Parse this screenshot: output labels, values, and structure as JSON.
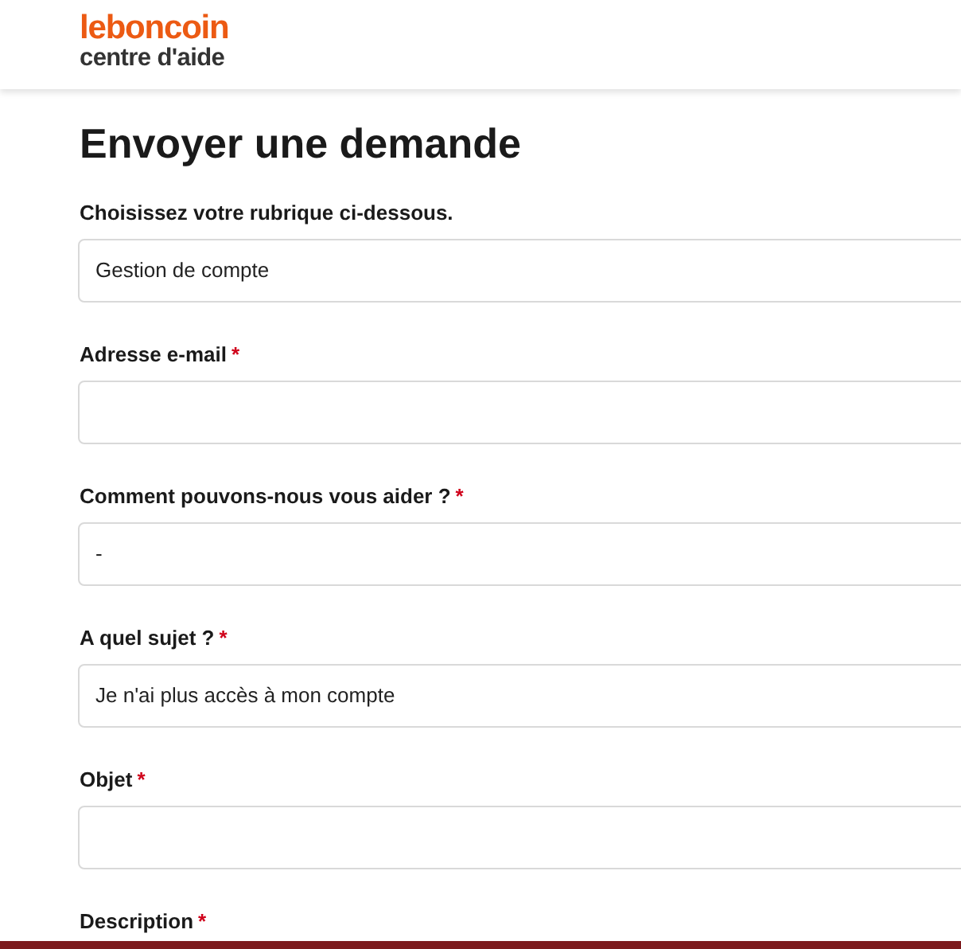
{
  "header": {
    "brand": "leboncoin",
    "subtitle": "centre d'aide"
  },
  "title": "Envoyer une demande",
  "fields": [
    {
      "label": "Choisissez votre rubrique ci-dessous.",
      "kind": "select",
      "value": "Gestion de compte"
    },
    {
      "label": "Adresse e-mail",
      "required_mark": "*",
      "kind": "input"
    },
    {
      "label": "Comment pouvons-nous vous aider ?",
      "required_mark": "*",
      "kind": "select",
      "value": "-"
    },
    {
      "label": "A quel sujet ?",
      "required_mark": "*",
      "kind": "select",
      "value": "Je n'ai plus accès à mon compte"
    },
    {
      "label": "Objet",
      "required_mark": "*",
      "kind": "input"
    },
    {
      "label": "Description",
      "required_mark": "*",
      "kind": "label"
    }
  ]
}
